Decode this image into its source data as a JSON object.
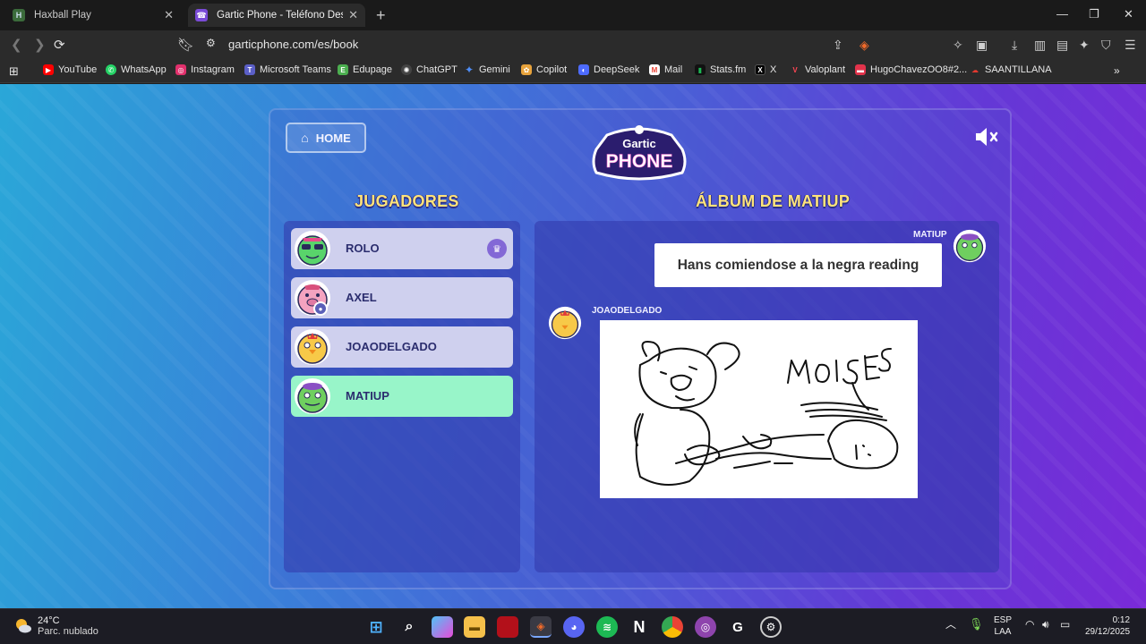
{
  "browser": {
    "tabs": [
      {
        "title": "Haxball Play",
        "icon": "haxball-icon",
        "active": false
      },
      {
        "title": "Gartic Phone - Teléfono Descomp",
        "icon": "gartic-icon",
        "active": true
      }
    ],
    "url": "garticphone.com/es/book",
    "bookmarks": [
      {
        "label": "YouTube",
        "color": "#ff0000"
      },
      {
        "label": "WhatsApp",
        "color": "#25d366"
      },
      {
        "label": "Instagram",
        "color": "#e1306c"
      },
      {
        "label": "Microsoft Teams",
        "color": "#5b5fc7"
      },
      {
        "label": "Edupage",
        "color": "#4caf50"
      },
      {
        "label": "ChatGPT",
        "color": "#cccccc"
      },
      {
        "label": "Gemini",
        "color": "#4f8ef7"
      },
      {
        "label": "Copilot",
        "color": "#e8a33c"
      },
      {
        "label": "DeepSeek",
        "color": "#4d6bfe"
      },
      {
        "label": "Mail",
        "color": "#ea4335"
      },
      {
        "label": "Stats.fm",
        "color": "#1db954"
      },
      {
        "label": "X",
        "color": "#000000"
      },
      {
        "label": "Valoplant",
        "color": "#ff4655"
      },
      {
        "label": "HugoChavezOO8#2...",
        "color": "#e2334b"
      },
      {
        "label": "SAANTILLANA",
        "color": "#e5392f"
      }
    ]
  },
  "game": {
    "home_label": "HOME",
    "logo_line1": "Gartic",
    "logo_line2": "PHONE",
    "players_heading": "JUGADORES",
    "album_heading": "ÁLBUM DE MATIUP",
    "players": [
      {
        "name": "ROLO",
        "owner": true,
        "active": false
      },
      {
        "name": "AXEL",
        "owner": false,
        "active": false
      },
      {
        "name": "JOAODELGADO",
        "owner": false,
        "active": false
      },
      {
        "name": "MATIUP",
        "owner": false,
        "active": true
      }
    ],
    "album": {
      "entries": [
        {
          "author": "MATIUP",
          "type": "text",
          "content": "Hans comiendose a la negra reading"
        },
        {
          "author": "JOAODELGADO",
          "type": "drawing",
          "drawing_text": "MOISES"
        }
      ]
    }
  },
  "taskbar": {
    "temperature": "24°C",
    "weather": "Parc. nublado",
    "lang1": "ESP",
    "lang2": "LAA",
    "time": "0:12",
    "date": "29/12/2025"
  }
}
